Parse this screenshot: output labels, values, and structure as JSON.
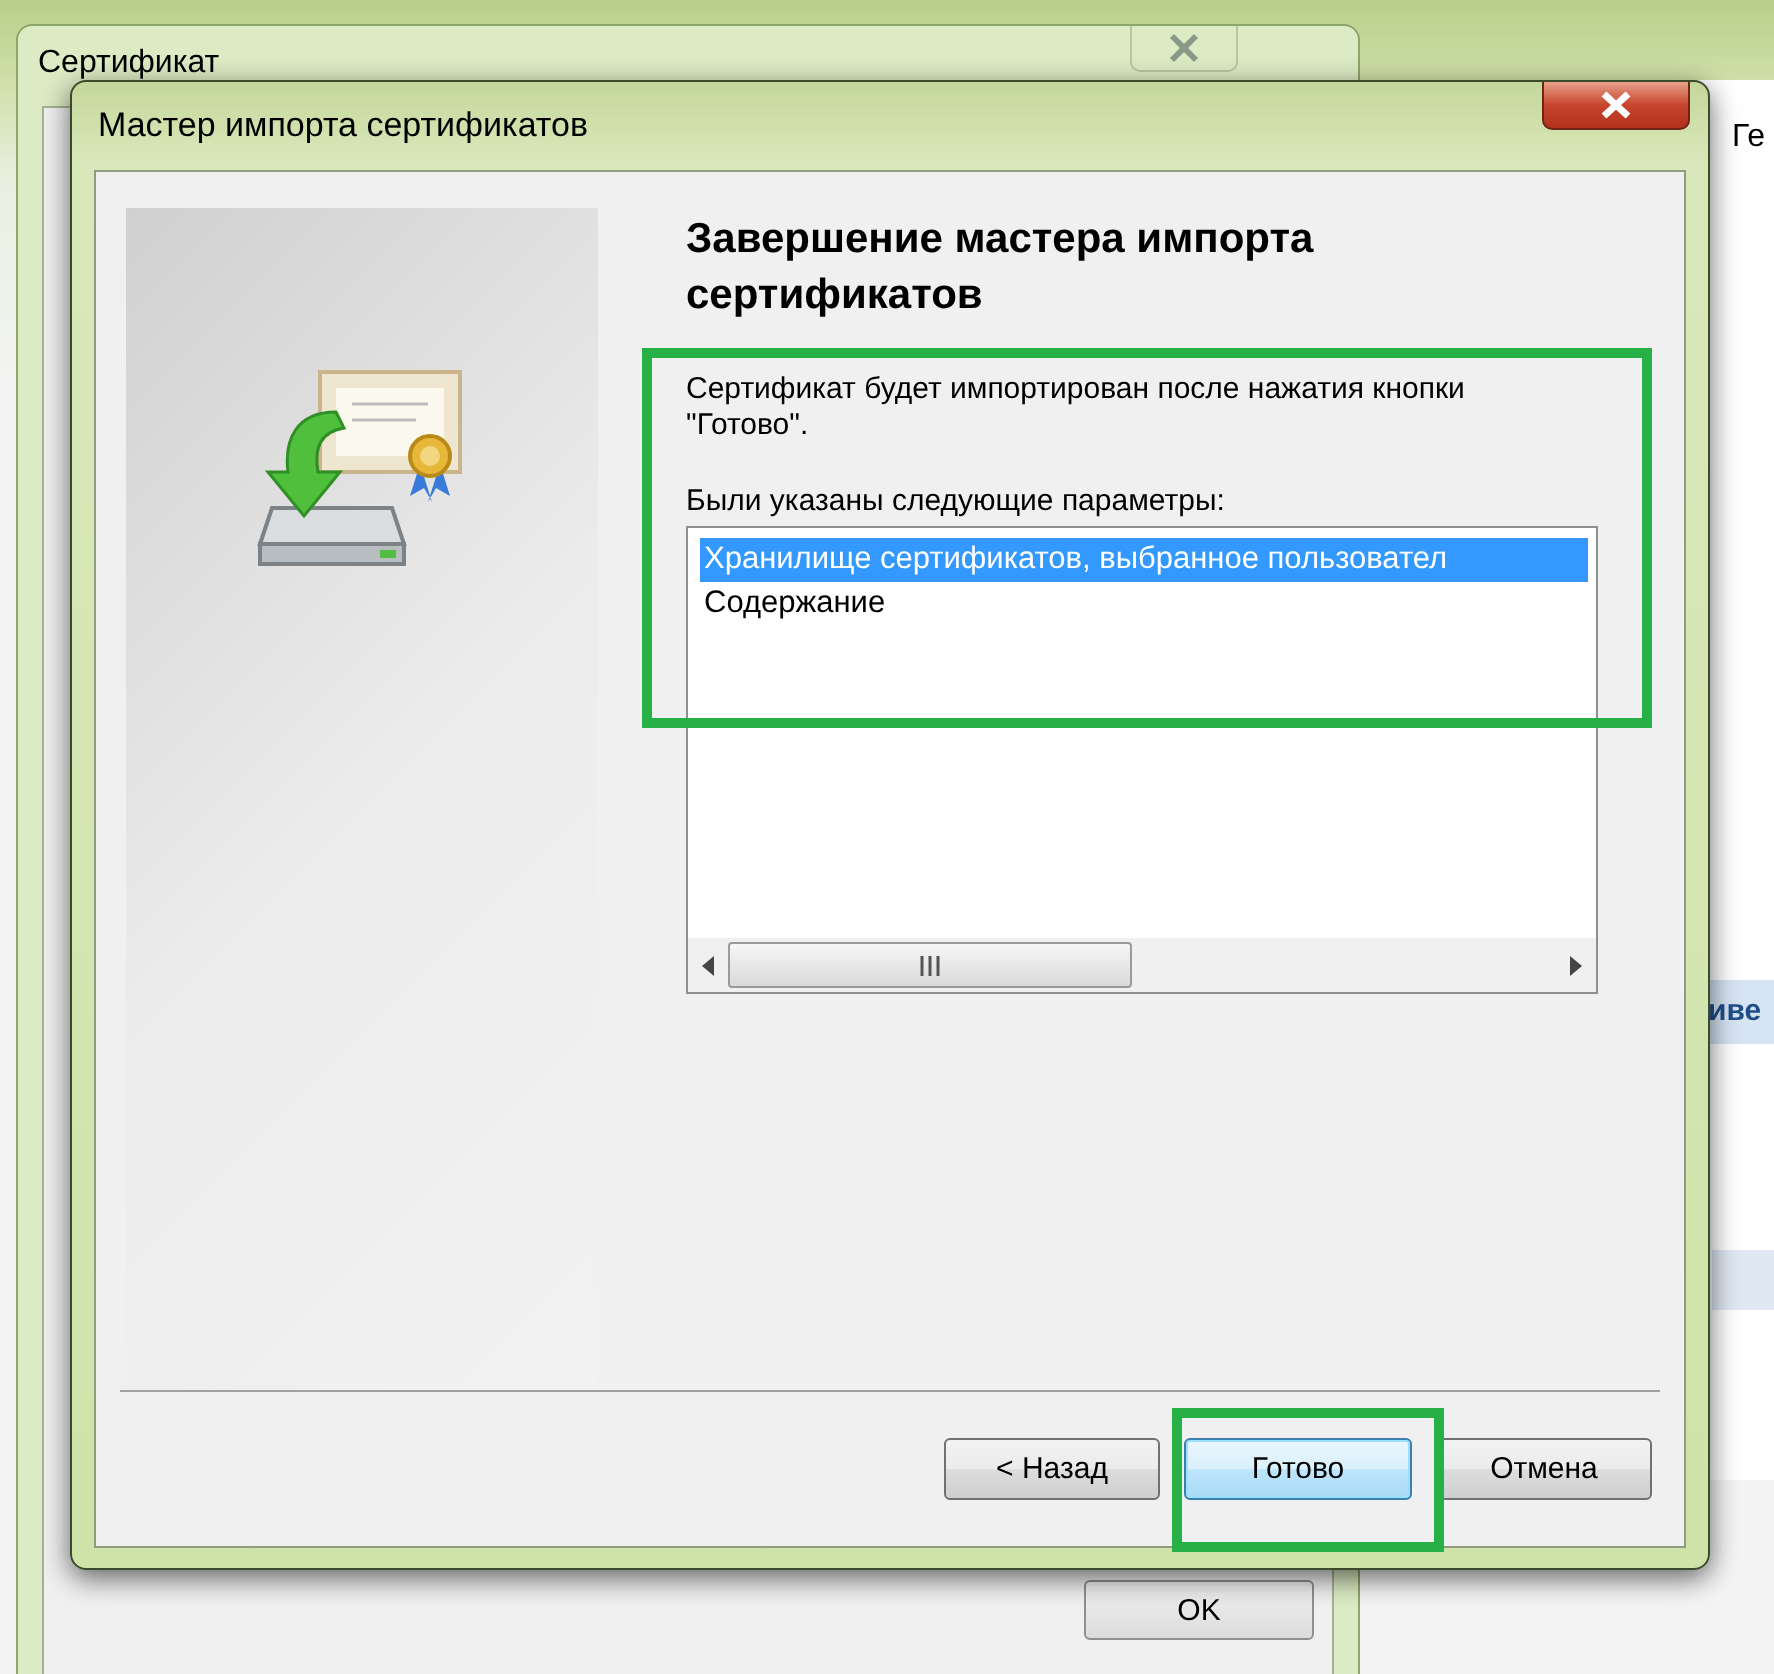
{
  "background_window": {
    "title": "Сертификат",
    "ok_button": "OK"
  },
  "right_window": {
    "title": "Ге",
    "link": "иве"
  },
  "dialog": {
    "title": "Мастер импорта сертификатов",
    "heading": "Завершение мастера импорта сертификатов",
    "message": "Сертификат будет импортирован после нажатия кнопки \"Готово\".",
    "list_label": "Были указаны следующие параметры:",
    "list_items": [
      {
        "text": "Хранилище сертификатов, выбранное пользовател",
        "selected": true
      },
      {
        "text": "Содержание",
        "selected": false
      }
    ],
    "buttons": [
      {
        "label": "< Назад",
        "focused": false
      },
      {
        "label": "Готово",
        "focused": true
      },
      {
        "label": "Отмена",
        "focused": false
      }
    ]
  }
}
